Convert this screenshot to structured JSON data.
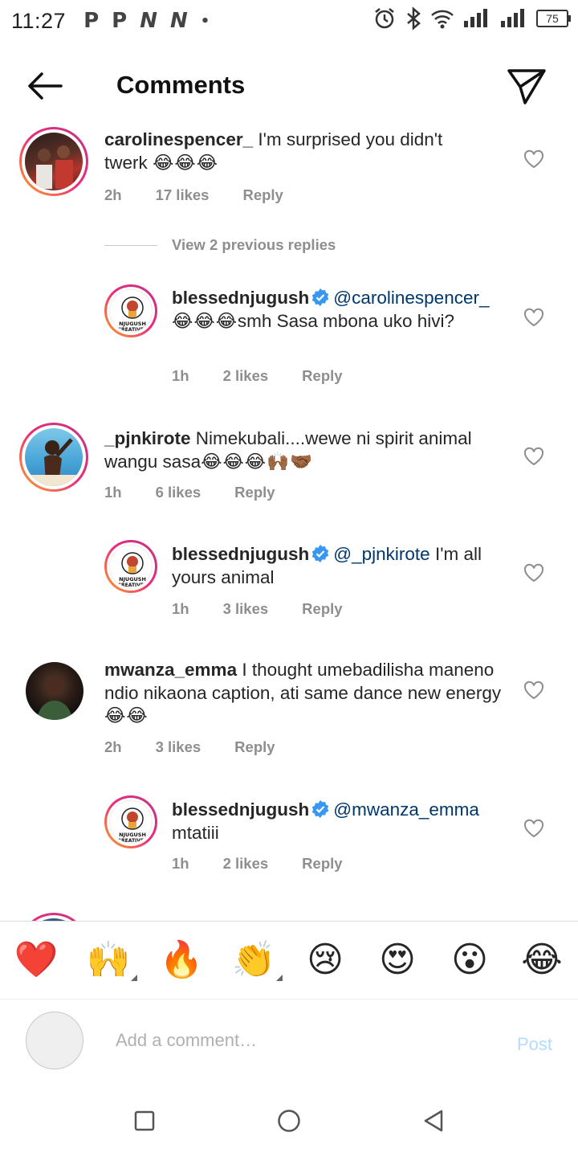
{
  "status_bar": {
    "time": "11:27",
    "notification_icons": [
      "P",
      "P",
      "N",
      "N",
      "•"
    ],
    "battery": "75"
  },
  "header": {
    "title": "Comments"
  },
  "comments": [
    {
      "username": "carolinespencer_",
      "text": " I'm surprised you didn't twerk ",
      "emojis": "😂😂😂",
      "time": "2h",
      "likes": "17 likes",
      "reply": "Reply"
    },
    {
      "view_replies": "View 2 previous replies"
    },
    {
      "username": "blessednjugush",
      "mention": "@carolinespencer_",
      "emojis": "😂😂😂",
      "text": "smh Sasa mbona uko hivi?",
      "time": "1h",
      "likes": "2 likes",
      "reply": "Reply"
    },
    {
      "username": "_pjnkirote",
      "text": " Nimekubali....wewe ni spirit animal wangu sasa",
      "emojis": "😂😂😂🙌🏾🤝🏾",
      "time": "1h",
      "likes": "6 likes",
      "reply": "Reply"
    },
    {
      "username": "blessednjugush",
      "mention": "@_pjnkirote",
      "text": " I'm all yours animal",
      "time": "1h",
      "likes": "3 likes",
      "reply": "Reply"
    },
    {
      "username": "mwanza_emma",
      "text": " I thought umebadilisha maneno ndio nikaona caption, ati same dance new energy ",
      "emojis": "😂😂",
      "time": "2h",
      "likes": "3 likes",
      "reply": "Reply"
    },
    {
      "username": "blessednjugush",
      "mention": "@mwanza_emma",
      "text": " mtatiii",
      "time": "1h",
      "likes": "2 likes",
      "reply": "Reply"
    }
  ],
  "avatar_logo_text": "NJUGUSH CREATIVES",
  "emoji_bar": [
    "❤️",
    "🙌",
    "🔥",
    "👏",
    "😢",
    "😍",
    "😮",
    "😂"
  ],
  "add_comment": {
    "placeholder": "Add a comment…",
    "post_label": "Post"
  },
  "colors": {
    "mention": "#00376b",
    "meta": "#8e8e8e",
    "post_disabled": "#b3dbff",
    "verified": "#3897f0"
  }
}
